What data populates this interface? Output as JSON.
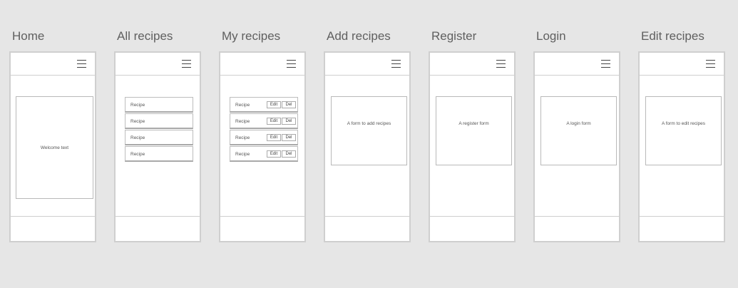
{
  "screens": [
    {
      "title": "Home",
      "content": "Welcome text"
    },
    {
      "title": "All recipes",
      "rows": [
        "Recipe",
        "Recipe",
        "Recipe",
        "Recipe"
      ]
    },
    {
      "title": "My recipes",
      "rows": [
        "Recipe",
        "Recipe",
        "Recipe",
        "Recipe"
      ],
      "edit_label": "Edit",
      "delete_label": "Del"
    },
    {
      "title": "Add recipes",
      "content": "A form to add recipes"
    },
    {
      "title": "Register",
      "content": "A register form"
    },
    {
      "title": "Login",
      "content": "A login form"
    },
    {
      "title": "Edit recipes",
      "content": "A form to edit recipes"
    }
  ]
}
